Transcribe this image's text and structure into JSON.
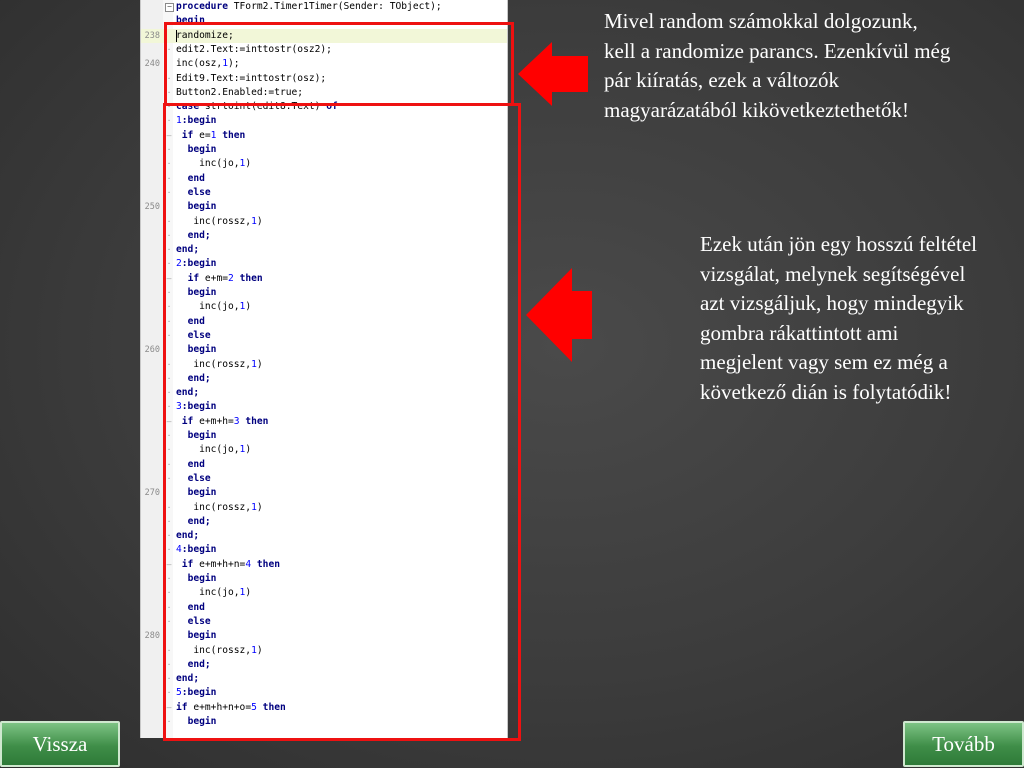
{
  "editor": {
    "lines": [
      {
        "num": "",
        "fold": "box",
        "segments": [
          [
            "kw",
            "procedure"
          ],
          [
            "t",
            " TForm2.Timer1Timer(Sender: TObject);"
          ]
        ]
      },
      {
        "num": "",
        "fold": "",
        "segments": [
          [
            "kw",
            "begin"
          ]
        ]
      },
      {
        "num": "238",
        "fold": "",
        "current": true,
        "segments": [
          [
            "t",
            "randomize;"
          ]
        ]
      },
      {
        "num": "",
        "fold": "·",
        "segments": [
          [
            "t",
            "edit2.Text:=inttostr(osz2);"
          ]
        ]
      },
      {
        "num": "240",
        "fold": "",
        "segments": [
          [
            "t",
            "inc(osz,"
          ],
          [
            "num",
            "1"
          ],
          [
            "t",
            ");"
          ]
        ]
      },
      {
        "num": "",
        "fold": "·",
        "segments": [
          [
            "t",
            "Edit9.Text:=inttostr(osz);"
          ]
        ]
      },
      {
        "num": "",
        "fold": "·",
        "segments": [
          [
            "t",
            "Button2.Enabled:=true;"
          ]
        ]
      },
      {
        "num": "",
        "fold": "·",
        "segments": [
          [
            "kw",
            "case"
          ],
          [
            "t",
            " strtoint(edit8.Text) "
          ],
          [
            "kw",
            "of"
          ]
        ]
      },
      {
        "num": "",
        "fold": "·",
        "segments": [
          [
            "num",
            "1"
          ],
          [
            "kw",
            ":begin"
          ]
        ]
      },
      {
        "num": "",
        "fold": "–",
        "segments": [
          [
            "t",
            " "
          ],
          [
            "kw",
            "if"
          ],
          [
            "t",
            " e="
          ],
          [
            "num",
            "1"
          ],
          [
            "t",
            " "
          ],
          [
            "kw",
            "then"
          ]
        ]
      },
      {
        "num": "",
        "fold": "·",
        "segments": [
          [
            "t",
            "  "
          ],
          [
            "kw",
            "begin"
          ]
        ]
      },
      {
        "num": "",
        "fold": "·",
        "segments": [
          [
            "t",
            "    inc(jo,"
          ],
          [
            "num",
            "1"
          ],
          [
            "t",
            ")"
          ]
        ]
      },
      {
        "num": "",
        "fold": "·",
        "segments": [
          [
            "t",
            "  "
          ],
          [
            "kw",
            "end"
          ]
        ]
      },
      {
        "num": "",
        "fold": "·",
        "segments": [
          [
            "t",
            "  "
          ],
          [
            "kw",
            "else"
          ]
        ]
      },
      {
        "num": "250",
        "fold": "",
        "segments": [
          [
            "t",
            "  "
          ],
          [
            "kw",
            "begin"
          ]
        ]
      },
      {
        "num": "",
        "fold": "·",
        "segments": [
          [
            "t",
            "   inc(rossz,"
          ],
          [
            "num",
            "1"
          ],
          [
            "t",
            ")"
          ]
        ]
      },
      {
        "num": "",
        "fold": "·",
        "segments": [
          [
            "t",
            "  "
          ],
          [
            "kw",
            "end;"
          ]
        ]
      },
      {
        "num": "",
        "fold": "·",
        "segments": [
          [
            "kw",
            "end;"
          ]
        ]
      },
      {
        "num": "",
        "fold": "·",
        "segments": [
          [
            "num",
            "2"
          ],
          [
            "kw",
            ":begin"
          ]
        ]
      },
      {
        "num": "",
        "fold": "–",
        "segments": [
          [
            "t",
            "  "
          ],
          [
            "kw",
            "if"
          ],
          [
            "t",
            " e+m="
          ],
          [
            "num",
            "2"
          ],
          [
            "t",
            " "
          ],
          [
            "kw",
            "then"
          ]
        ]
      },
      {
        "num": "",
        "fold": "·",
        "segments": [
          [
            "t",
            "  "
          ],
          [
            "kw",
            "begin"
          ]
        ]
      },
      {
        "num": "",
        "fold": "·",
        "segments": [
          [
            "t",
            "    inc(jo,"
          ],
          [
            "num",
            "1"
          ],
          [
            "t",
            ")"
          ]
        ]
      },
      {
        "num": "",
        "fold": "·",
        "segments": [
          [
            "t",
            "  "
          ],
          [
            "kw",
            "end"
          ]
        ]
      },
      {
        "num": "",
        "fold": "·",
        "segments": [
          [
            "t",
            "  "
          ],
          [
            "kw",
            "else"
          ]
        ]
      },
      {
        "num": "260",
        "fold": "",
        "segments": [
          [
            "t",
            "  "
          ],
          [
            "kw",
            "begin"
          ]
        ]
      },
      {
        "num": "",
        "fold": "·",
        "segments": [
          [
            "t",
            "   inc(rossz,"
          ],
          [
            "num",
            "1"
          ],
          [
            "t",
            ")"
          ]
        ]
      },
      {
        "num": "",
        "fold": "·",
        "segments": [
          [
            "t",
            "  "
          ],
          [
            "kw",
            "end;"
          ]
        ]
      },
      {
        "num": "",
        "fold": "·",
        "segments": [
          [
            "kw",
            "end;"
          ]
        ]
      },
      {
        "num": "",
        "fold": "·",
        "segments": [
          [
            "num",
            "3"
          ],
          [
            "kw",
            ":begin"
          ]
        ]
      },
      {
        "num": "",
        "fold": "–",
        "segments": [
          [
            "t",
            " "
          ],
          [
            "kw",
            "if"
          ],
          [
            "t",
            " e+m+h="
          ],
          [
            "num",
            "3"
          ],
          [
            "t",
            " "
          ],
          [
            "kw",
            "then"
          ]
        ]
      },
      {
        "num": "",
        "fold": "·",
        "segments": [
          [
            "t",
            "  "
          ],
          [
            "kw",
            "begin"
          ]
        ]
      },
      {
        "num": "",
        "fold": "·",
        "segments": [
          [
            "t",
            "    inc(jo,"
          ],
          [
            "num",
            "1"
          ],
          [
            "t",
            ")"
          ]
        ]
      },
      {
        "num": "",
        "fold": "·",
        "segments": [
          [
            "t",
            "  "
          ],
          [
            "kw",
            "end"
          ]
        ]
      },
      {
        "num": "",
        "fold": "·",
        "segments": [
          [
            "t",
            "  "
          ],
          [
            "kw",
            "else"
          ]
        ]
      },
      {
        "num": "270",
        "fold": "",
        "segments": [
          [
            "t",
            "  "
          ],
          [
            "kw",
            "begin"
          ]
        ]
      },
      {
        "num": "",
        "fold": "·",
        "segments": [
          [
            "t",
            "   inc(rossz,"
          ],
          [
            "num",
            "1"
          ],
          [
            "t",
            ")"
          ]
        ]
      },
      {
        "num": "",
        "fold": "·",
        "segments": [
          [
            "t",
            "  "
          ],
          [
            "kw",
            "end;"
          ]
        ]
      },
      {
        "num": "",
        "fold": "·",
        "segments": [
          [
            "kw",
            "end;"
          ]
        ]
      },
      {
        "num": "",
        "fold": "·",
        "segments": [
          [
            "num",
            "4"
          ],
          [
            "kw",
            ":begin"
          ]
        ]
      },
      {
        "num": "",
        "fold": "–",
        "segments": [
          [
            "t",
            " "
          ],
          [
            "kw",
            "if"
          ],
          [
            "t",
            " e+m+h+n="
          ],
          [
            "num",
            "4"
          ],
          [
            "t",
            " "
          ],
          [
            "kw",
            "then"
          ]
        ]
      },
      {
        "num": "",
        "fold": "·",
        "segments": [
          [
            "t",
            "  "
          ],
          [
            "kw",
            "begin"
          ]
        ]
      },
      {
        "num": "",
        "fold": "·",
        "segments": [
          [
            "t",
            "    inc(jo,"
          ],
          [
            "num",
            "1"
          ],
          [
            "t",
            ")"
          ]
        ]
      },
      {
        "num": "",
        "fold": "·",
        "segments": [
          [
            "t",
            "  "
          ],
          [
            "kw",
            "end"
          ]
        ]
      },
      {
        "num": "",
        "fold": "·",
        "segments": [
          [
            "t",
            "  "
          ],
          [
            "kw",
            "else"
          ]
        ]
      },
      {
        "num": "280",
        "fold": "",
        "segments": [
          [
            "t",
            "  "
          ],
          [
            "kw",
            "begin"
          ]
        ]
      },
      {
        "num": "",
        "fold": "·",
        "segments": [
          [
            "t",
            "   inc(rossz,"
          ],
          [
            "num",
            "1"
          ],
          [
            "t",
            ")"
          ]
        ]
      },
      {
        "num": "",
        "fold": "·",
        "segments": [
          [
            "t",
            "  "
          ],
          [
            "kw",
            "end;"
          ]
        ]
      },
      {
        "num": "",
        "fold": "·",
        "segments": [
          [
            "kw",
            "end;"
          ]
        ]
      },
      {
        "num": "",
        "fold": "·",
        "segments": [
          [
            "num",
            "5"
          ],
          [
            "kw",
            ":begin"
          ]
        ]
      },
      {
        "num": "",
        "fold": "–",
        "segments": [
          [
            "kw",
            "if"
          ],
          [
            "t",
            " e+m+h+n+o="
          ],
          [
            "num",
            "5"
          ],
          [
            "t",
            " "
          ],
          [
            "kw",
            "then"
          ]
        ]
      },
      {
        "num": "",
        "fold": "·",
        "segments": [
          [
            "t",
            "  "
          ],
          [
            "kw",
            "begin"
          ]
        ]
      }
    ]
  },
  "text": {
    "desc_1": "Mivel random számokkal dolgozunk, kell a randomize parancs. Ezenkívül még pár kiíratás, ezek a változók magyarázatából kikövetkeztethetők!",
    "desc_2": "Ezek után jön egy hosszú feltétel vizsgálat, melynek segítségével azt vizsgáljuk, hogy mindegyik gombra rákattintott ami megjelent vagy sem ez még a következő dián is folytatódik!"
  },
  "nav": {
    "back_label": "Vissza",
    "next_label": "Tovább"
  },
  "colors": {
    "highlight": "#ee1111",
    "arrow": "#ff0000",
    "button": "#4a9a53"
  }
}
